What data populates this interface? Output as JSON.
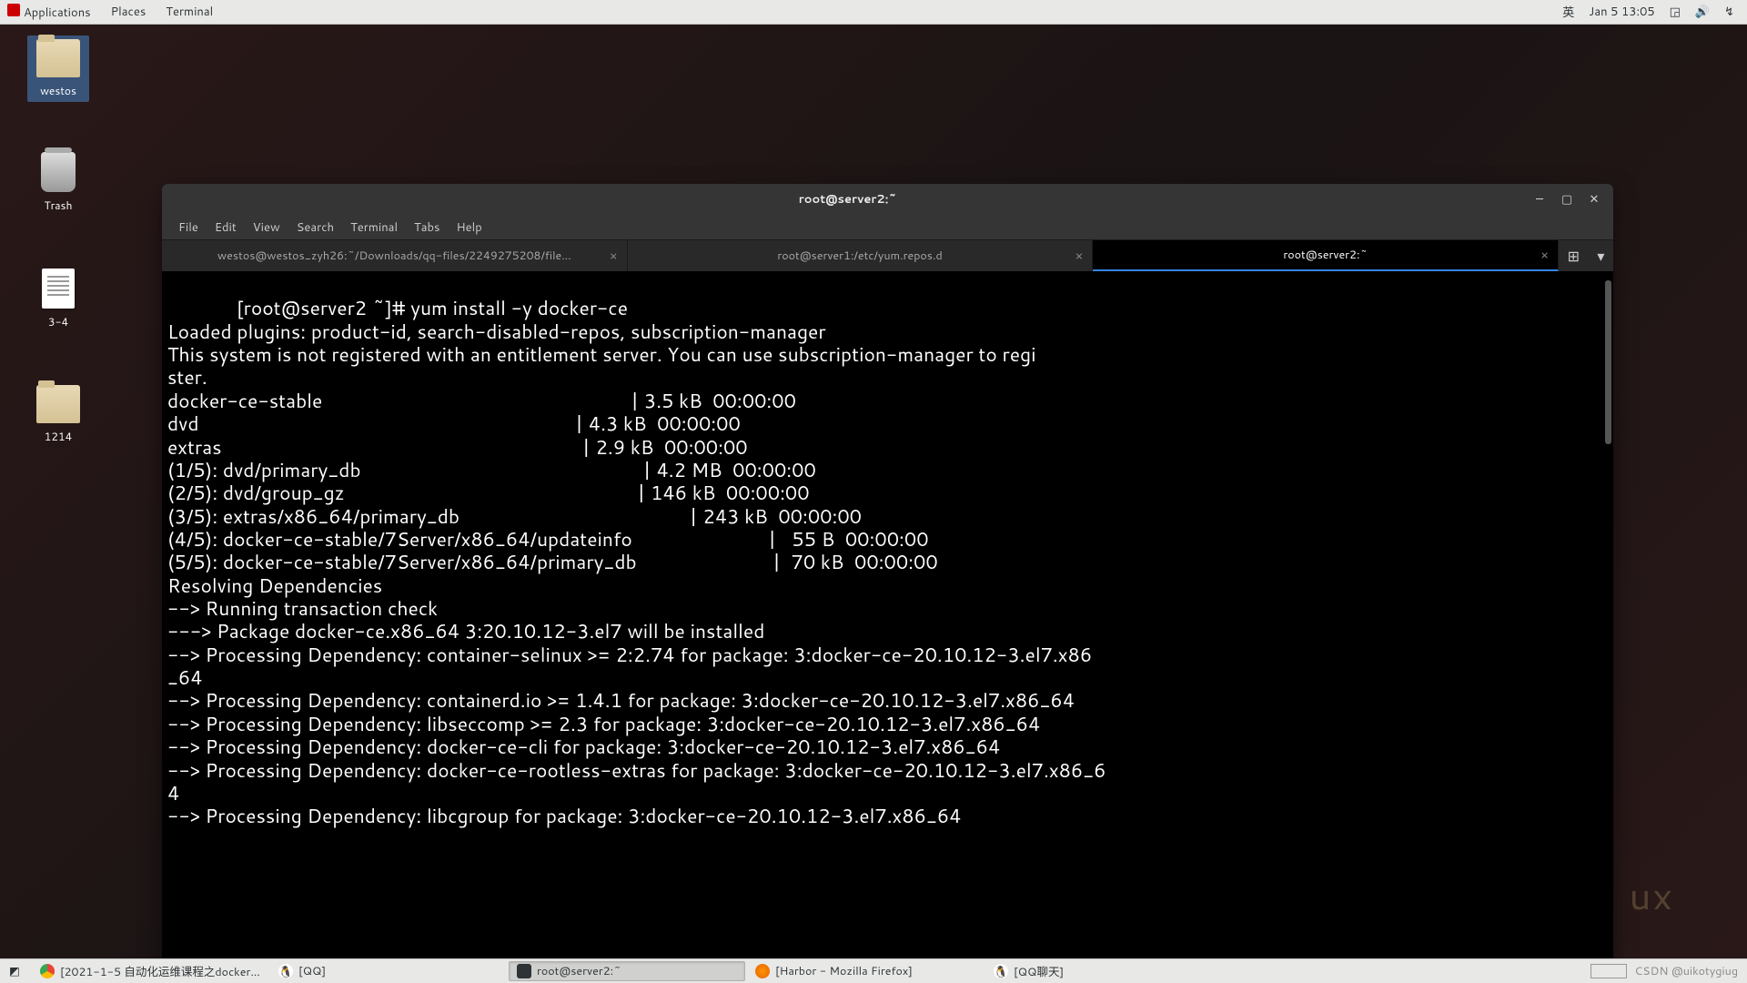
{
  "topbar": {
    "apps": "Applications",
    "places": "Places",
    "terminal": "Terminal",
    "lang": "英",
    "date": "Jan 5",
    "time": "13:05"
  },
  "desktop_icons": {
    "westos": "westos",
    "trash": "Trash",
    "doc": "3-4",
    "folder2": "1214"
  },
  "desktop_watermark": "ux",
  "terminal": {
    "title": "root@server2:~",
    "menu": {
      "file": "File",
      "edit": "Edit",
      "view": "View",
      "search": "Search",
      "terminal": "Terminal",
      "tabs": "Tabs",
      "help": "Help"
    },
    "tabs": {
      "t1": "westos@westos_zyh26:~/Downloads/qq-files/2249275208/file…",
      "t2": "root@server1:/etc/yum.repos.d",
      "t3": "root@server2:~"
    },
    "content": "[root@server2 ~]# yum install -y docker-ce\nLoaded plugins: product-id, search-disabled-repos, subscription-manager\nThis system is not registered with an entitlement server. You can use subscription-manager to regi\nster.\ndocker-ce-stable                                                           | 3.5 kB  00:00:00\ndvd                                                                        | 4.3 kB  00:00:00\nextras                                                                     | 2.9 kB  00:00:00\n(1/5): dvd/primary_db                                                      | 4.2 MB  00:00:00\n(2/5): dvd/group_gz                                                        | 146 kB  00:00:00\n(3/5): extras/x86_64/primary_db                                            | 243 kB  00:00:00\n(4/5): docker-ce-stable/7Server/x86_64/updateinfo                          |   55 B  00:00:00\n(5/5): docker-ce-stable/7Server/x86_64/primary_db                          |  70 kB  00:00:00\nResolving Dependencies\n--> Running transaction check\n---> Package docker-ce.x86_64 3:20.10.12-3.el7 will be installed\n--> Processing Dependency: container-selinux >= 2:2.74 for package: 3:docker-ce-20.10.12-3.el7.x86\n_64\n--> Processing Dependency: containerd.io >= 1.4.1 for package: 3:docker-ce-20.10.12-3.el7.x86_64\n--> Processing Dependency: libseccomp >= 2.3 for package: 3:docker-ce-20.10.12-3.el7.x86_64\n--> Processing Dependency: docker-ce-cli for package: 3:docker-ce-20.10.12-3.el7.x86_64\n--> Processing Dependency: docker-ce-rootless-extras for package: 3:docker-ce-20.10.12-3.el7.x86_6\n4\n--> Processing Dependency: libcgroup for package: 3:docker-ce-20.10.12-3.el7.x86_64"
  },
  "bottombar": {
    "t1": "[2021-1-5 自动化运维课程之docker…",
    "t2": "[QQ]",
    "t3": "root@server2:~",
    "t4": "[Harbor - Mozilla Firefox]",
    "t5": "[QQ聊天]",
    "watermark": "CSDN @uikotygiug"
  }
}
